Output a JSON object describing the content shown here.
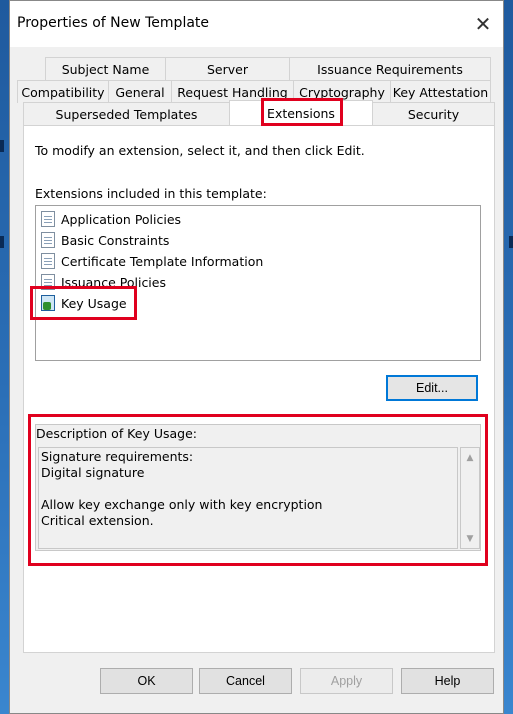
{
  "window": {
    "title": "Properties of New Template",
    "close_glyph": "✕"
  },
  "tabs": {
    "row1": [
      "Subject Name",
      "Server",
      "Issuance Requirements"
    ],
    "row2": [
      "Compatibility",
      "General",
      "Request Handling",
      "Cryptography",
      "Key Attestation"
    ],
    "row3": [
      "Superseded Templates",
      "Extensions",
      "Security"
    ],
    "active": "Extensions"
  },
  "panel": {
    "instruction": "To modify an extension, select it, and then click Edit.",
    "extensions_label": "Extensions included in this template:",
    "extensions": [
      {
        "label": "Application Policies",
        "icon": "certificate-extension-icon"
      },
      {
        "label": "Basic Constraints",
        "icon": "certificate-extension-icon"
      },
      {
        "label": "Certificate Template Information",
        "icon": "certificate-extension-icon"
      },
      {
        "label": "Issuance Policies",
        "icon": "certificate-extension-icon"
      },
      {
        "label": "Key Usage",
        "icon": "key-usage-icon",
        "selected": true
      }
    ],
    "edit_button": "Edit...",
    "description_label": "Description of Key Usage:",
    "description_text": "Signature requirements:\nDigital signature\n\nAllow key exchange only with key encryption\nCritical extension."
  },
  "buttons": {
    "ok": "OK",
    "cancel": "Cancel",
    "apply": "Apply",
    "help": "Help"
  },
  "colors": {
    "highlight_box": "#e0001e",
    "focus_border": "#0078d7"
  }
}
